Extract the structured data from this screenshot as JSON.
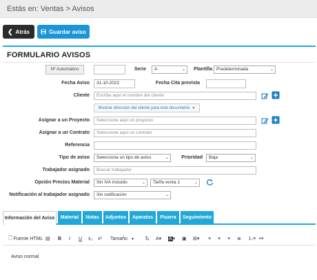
{
  "breadcrumb": "Estás en: Ventas > Avisos",
  "actions": {
    "back_label": "Atrás",
    "save_label": "Guardar aviso"
  },
  "form": {
    "title": "FORMULARIO AVISOS",
    "numero": "Nº Automático",
    "serie_label": "Serie",
    "serie_value": "A",
    "plantilla_label": "Plantilla",
    "plantilla_value": "Predeterminada",
    "fecha_aviso_label": "Fecha Aviso",
    "fecha_aviso_value": "31-10-2022",
    "fecha_cita_label": "Fecha Cita prevista",
    "fecha_cita_value": "",
    "cliente_label": "Cliente",
    "cliente_placeholder": "Escriba aquí el nombre del cliente",
    "mostrar_direccion": "Mostrar direccion del cliente para este documento",
    "proyecto_label": "Asignar a un Proyecto",
    "proyecto_placeholder": "Seleccione aquí un proyecto",
    "contrato_label": "Asignar a un Contrato",
    "contrato_placeholder": "Seleccione aquí un contrato",
    "referencia_label": "Referencia",
    "referencia_value": "",
    "tipo_label": "Tipo de aviso",
    "tipo_value": "Selecciona un tipo de aviso",
    "prioridad_label": "Prioridad",
    "prioridad_value": "Baja",
    "trabajador_label": "Trabajador asignado",
    "trabajador_placeholder": "Buscar trabajador",
    "precios_label": "Opción Precios Material",
    "precios_value": "Sin IVA incluido",
    "tarifa_value": "Tarifa venta 1",
    "notificacion_label": "Notificación al trabajador asignado",
    "notificacion_value": "Sin notificación"
  },
  "tabs": [
    "Información del Aviso",
    "Material",
    "Notas",
    "Adjuntos",
    "Aparatos",
    "Pizarra",
    "Seguimiento"
  ],
  "editor": {
    "source_label": "Fuente HTML",
    "size_label": "Tamaño",
    "content": "Aviso normal"
  },
  "colors": {
    "accent": "#1fa9d8",
    "tab": "#22a8d8",
    "dark_button": "#2b2b2b",
    "save_button": "#1a95d6",
    "link": "#1a7fc1"
  }
}
